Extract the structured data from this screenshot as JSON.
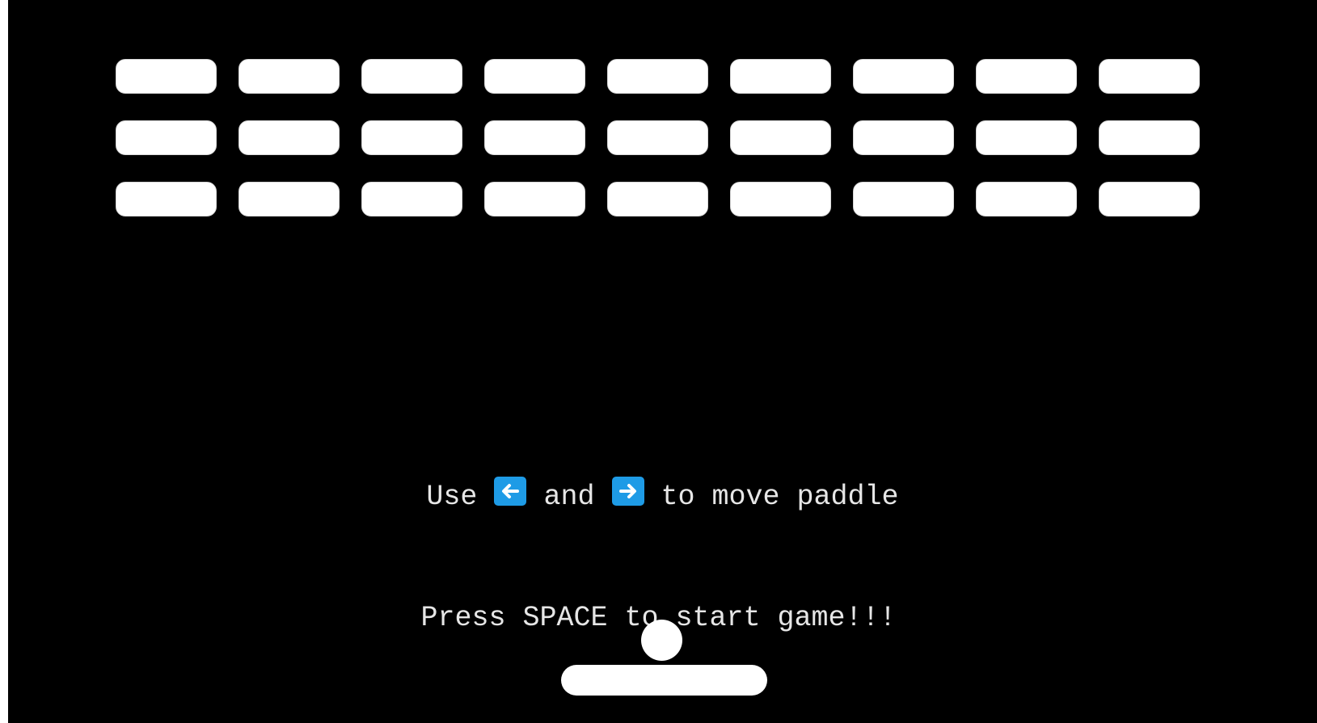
{
  "game": {
    "background_color": "#000000",
    "brick_color": "#ffffff",
    "ball_color": "#ffffff",
    "paddle_color": "#ffffff",
    "key_icon_color": "#1e9be6",
    "bricks": {
      "rows": 3,
      "columns": 9
    }
  },
  "instructions": {
    "line1_use": "Use",
    "left_key_icon": "left-arrow-key-icon",
    "line1_and": "and",
    "right_key_icon": "right-arrow-key-icon",
    "line1_rest": "to move paddle",
    "line2": "Press SPACE to start game!!!"
  }
}
